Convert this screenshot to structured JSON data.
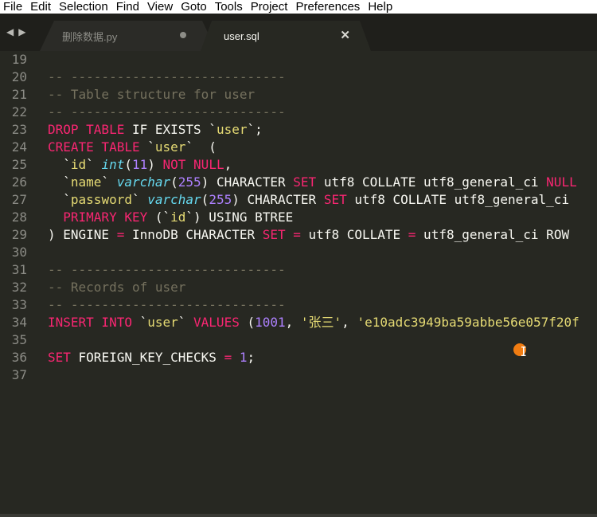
{
  "menu": [
    "File",
    "Edit",
    "Selection",
    "Find",
    "View",
    "Goto",
    "Tools",
    "Project",
    "Preferences",
    "Help"
  ],
  "tabs": [
    {
      "label": "删除数据.py",
      "active": false,
      "dirty": true
    },
    {
      "label": "user.sql",
      "active": true,
      "dirty": false
    }
  ],
  "icons": {
    "back": "chevron-left-icon",
    "forward": "chevron-right-icon",
    "close": "close-icon",
    "cursor": "mouse-cursor-icon"
  },
  "colors": {
    "background": "#272822",
    "comment": "#75715e",
    "keyword": "#f92672",
    "string": "#e6db74",
    "number": "#ae81ff",
    "type": "#66d9ef",
    "plain": "#f8f8f2"
  },
  "lines": [
    {
      "n": "19",
      "tokens": []
    },
    {
      "n": "20",
      "tokens": [
        [
          "c",
          "-- ----------------------------"
        ]
      ]
    },
    {
      "n": "21",
      "tokens": [
        [
          "c",
          "-- Table structure for user"
        ]
      ]
    },
    {
      "n": "22",
      "tokens": [
        [
          "c",
          "-- ----------------------------"
        ]
      ]
    },
    {
      "n": "23",
      "tokens": [
        [
          "k",
          "DROP TABLE"
        ],
        [
          "p",
          " IF EXISTS "
        ],
        [
          "p",
          "`"
        ],
        [
          "s",
          "user"
        ],
        [
          "p",
          "`;"
        ]
      ]
    },
    {
      "n": "24",
      "tokens": [
        [
          "k",
          "CREATE TABLE"
        ],
        [
          "p",
          " `"
        ],
        [
          "s",
          "user"
        ],
        [
          "p",
          "`  ("
        ]
      ]
    },
    {
      "n": "25",
      "tokens": [
        [
          "p",
          "  `"
        ],
        [
          "s",
          "id"
        ],
        [
          "p",
          "` "
        ],
        [
          "t",
          "int"
        ],
        [
          "p",
          "("
        ],
        [
          "n",
          "11"
        ],
        [
          "p",
          ") "
        ],
        [
          "k",
          "NOT NULL"
        ],
        [
          "p",
          ","
        ]
      ]
    },
    {
      "n": "26",
      "tokens": [
        [
          "p",
          "  `"
        ],
        [
          "s",
          "name"
        ],
        [
          "p",
          "` "
        ],
        [
          "t",
          "varchar"
        ],
        [
          "p",
          "("
        ],
        [
          "n",
          "255"
        ],
        [
          "p",
          ") CHARACTER "
        ],
        [
          "k",
          "SET"
        ],
        [
          "p",
          " utf8 COLLATE utf8_general_ci "
        ],
        [
          "k",
          "NULL"
        ]
      ]
    },
    {
      "n": "27",
      "tokens": [
        [
          "p",
          "  `"
        ],
        [
          "s",
          "password"
        ],
        [
          "p",
          "` "
        ],
        [
          "t",
          "varchar"
        ],
        [
          "p",
          "("
        ],
        [
          "n",
          "255"
        ],
        [
          "p",
          ") CHARACTER "
        ],
        [
          "k",
          "SET"
        ],
        [
          "p",
          " utf8 COLLATE utf8_general_ci"
        ]
      ]
    },
    {
      "n": "28",
      "tokens": [
        [
          "p",
          "  "
        ],
        [
          "k",
          "PRIMARY KEY"
        ],
        [
          "p",
          " (`"
        ],
        [
          "s",
          "id"
        ],
        [
          "p",
          "`) USING BTREE"
        ]
      ]
    },
    {
      "n": "29",
      "tokens": [
        [
          "p",
          ") ENGINE "
        ],
        [
          "k",
          "="
        ],
        [
          "p",
          " InnoDB CHARACTER "
        ],
        [
          "k",
          "SET"
        ],
        [
          "p",
          " "
        ],
        [
          "k",
          "="
        ],
        [
          "p",
          " utf8 COLLATE "
        ],
        [
          "k",
          "="
        ],
        [
          "p",
          " utf8_general_ci ROW"
        ]
      ]
    },
    {
      "n": "30",
      "tokens": []
    },
    {
      "n": "31",
      "tokens": [
        [
          "c",
          "-- ----------------------------"
        ]
      ]
    },
    {
      "n": "32",
      "tokens": [
        [
          "c",
          "-- Records of user"
        ]
      ]
    },
    {
      "n": "33",
      "tokens": [
        [
          "c",
          "-- ----------------------------"
        ]
      ]
    },
    {
      "n": "34",
      "tokens": [
        [
          "k",
          "INSERT INTO"
        ],
        [
          "p",
          " `"
        ],
        [
          "s",
          "user"
        ],
        [
          "p",
          "` "
        ],
        [
          "k",
          "VALUES"
        ],
        [
          "p",
          " ("
        ],
        [
          "n",
          "1001"
        ],
        [
          "p",
          ", "
        ],
        [
          "s",
          "'张三'"
        ],
        [
          "p",
          ", "
        ],
        [
          "s",
          "'e10adc3949ba59abbe56e057f20f"
        ]
      ]
    },
    {
      "n": "35",
      "tokens": []
    },
    {
      "n": "36",
      "tokens": [
        [
          "k",
          "SET"
        ],
        [
          "p",
          " FOREIGN_KEY_CHECKS "
        ],
        [
          "k",
          "="
        ],
        [
          "p",
          " "
        ],
        [
          "n",
          "1"
        ],
        [
          "p",
          ";"
        ]
      ]
    },
    {
      "n": "37",
      "tokens": []
    }
  ]
}
